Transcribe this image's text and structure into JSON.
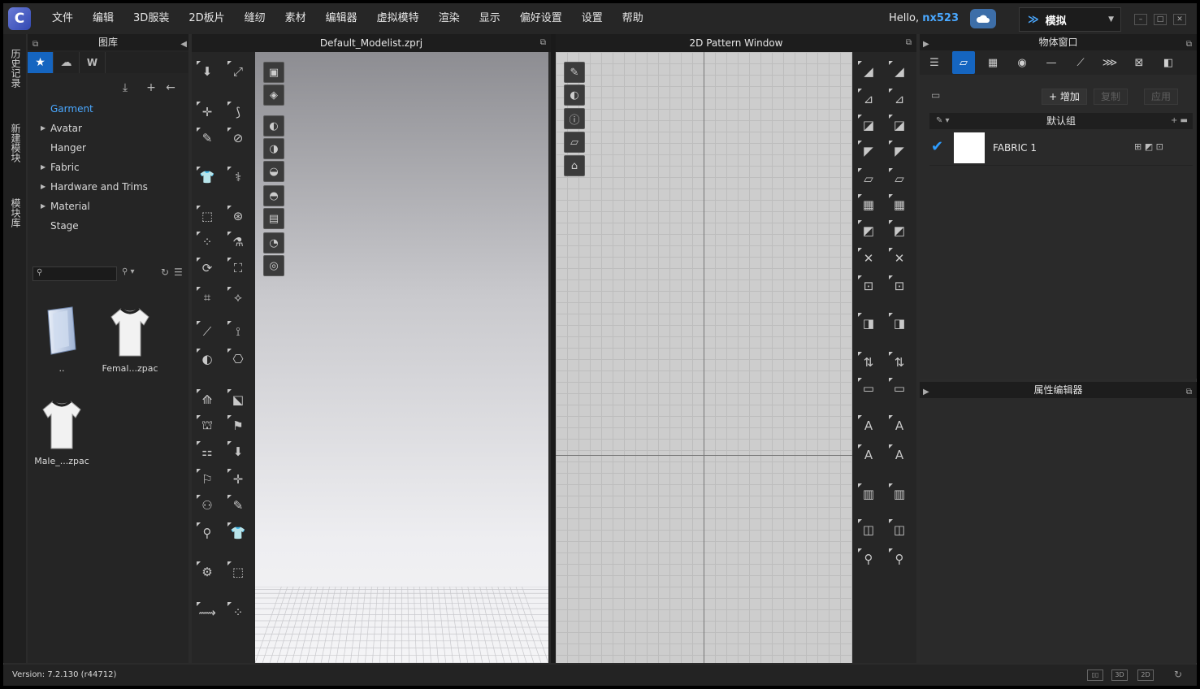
{
  "app": {
    "logo_glyph": "C",
    "menu": [
      "文件",
      "编辑",
      "3D服装",
      "2D板片",
      "缝纫",
      "素材",
      "编辑器",
      "虚拟模特",
      "渲染",
      "显示",
      "偏好设置",
      "设置",
      "帮助"
    ],
    "hello_prefix": "Hello,",
    "username": "nx523",
    "mode": "模拟",
    "accent_color": "#1565c0",
    "link_color": "#4aa8ff"
  },
  "side_tabs": [
    "历史记录",
    "新建模块",
    "模块库"
  ],
  "library": {
    "title": "图库",
    "tree": [
      {
        "label": "Garment",
        "expandable": false,
        "selected": true
      },
      {
        "label": "Avatar",
        "expandable": true
      },
      {
        "label": "Hanger",
        "expandable": false
      },
      {
        "label": "Fabric",
        "expandable": true
      },
      {
        "label": "Hardware and Trims",
        "expandable": true
      },
      {
        "label": "Material",
        "expandable": true
      },
      {
        "label": "Stage",
        "expandable": false
      }
    ],
    "files": [
      {
        "label": "..",
        "icon": "folder-up-icon"
      },
      {
        "label": "Femal...zpac",
        "icon": "female-shirt-icon"
      },
      {
        "label": "Male_...zpac",
        "icon": "male-shirt-icon"
      }
    ]
  },
  "window3d": {
    "title": "Default_Modelist.zprj"
  },
  "window2d": {
    "title": "2D Pattern Window"
  },
  "object_window": {
    "title": "物体窗口",
    "add_label": "增加",
    "copy_label": "复制",
    "apply_label": "应用",
    "group_label": "默认组",
    "fabrics": [
      {
        "name": "FABRIC 1",
        "color": "#ffffff",
        "checked": true
      }
    ]
  },
  "property_editor": {
    "title": "属性编辑器"
  },
  "status": {
    "version": "Version: 7.2.130 (r44712)",
    "view_3d": "3D",
    "view_2d": "2D"
  }
}
